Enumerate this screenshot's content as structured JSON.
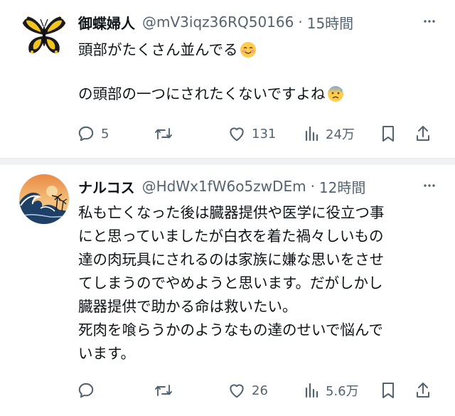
{
  "tweets": [
    {
      "name": "御蝶婦人",
      "handle": "@mV3iqz36RQ50166",
      "separator": "·",
      "time": "15時間",
      "lines": [
        "頭部がたくさん並んでる",
        "",
        "の頭部の一つにされたくないですよね"
      ],
      "line_emojis": [
        "smiling-blush-emoji",
        "",
        "anxious-sweat-emoji"
      ],
      "avatar_icon": "butterfly-avatar",
      "actions": {
        "reply": "5",
        "retweet": "",
        "like": "131",
        "views": "24万"
      }
    },
    {
      "name": "ナルコス",
      "handle": "@HdWx1fW6o5zwDEm",
      "separator": "·",
      "time": "12時間",
      "lines": [
        "私も亡くなった後は臓器提供や医学に役立つ事",
        "にと思っていましたが白衣を着た禍々しいもの",
        "達の肉玩具にされるのは家族に嫌な思いをさせ",
        "てしまうのでやめようと思います。だがしかし",
        "臓器提供で助かる命は救いたい。",
        "死肉を喰らうかのようなもの達のせいで悩んで",
        "います。"
      ],
      "avatar_icon": "great-wave-avatar",
      "actions": {
        "reply": "",
        "retweet": "",
        "like": "26",
        "views": "5.6万"
      }
    }
  ],
  "colors": {
    "text": "#0f1419",
    "secondary": "#536471",
    "separator": "#f0f2f4"
  }
}
